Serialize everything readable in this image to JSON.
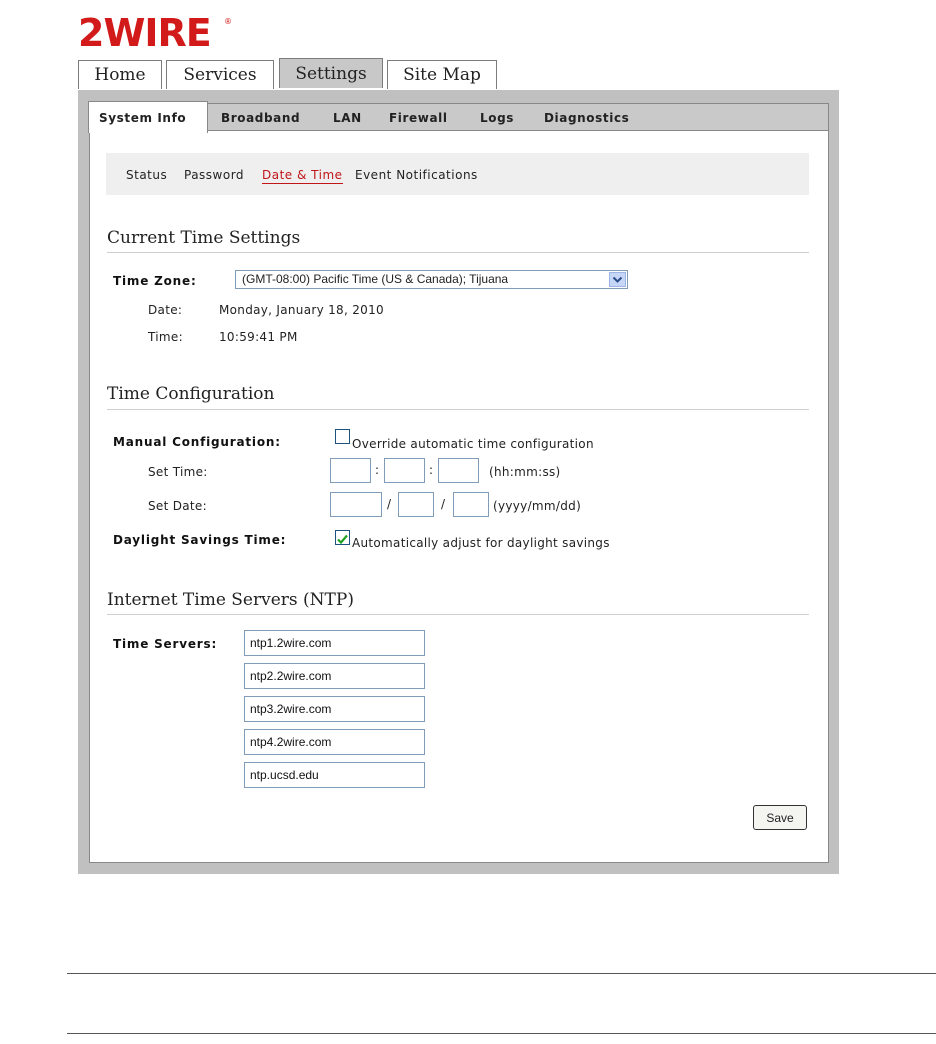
{
  "brand": {
    "logo_text": "2WIRE"
  },
  "top_tabs": [
    {
      "label": "Home"
    },
    {
      "label": "Services"
    },
    {
      "label": "Settings",
      "active": true
    },
    {
      "label": "Site Map"
    }
  ],
  "sub_tabs": [
    {
      "label": "System Info",
      "active": true
    },
    {
      "label": "Broadband"
    },
    {
      "label": "LAN"
    },
    {
      "label": "Firewall"
    },
    {
      "label": "Logs"
    },
    {
      "label": "Diagnostics"
    }
  ],
  "subnav": [
    {
      "label": "Status"
    },
    {
      "label": "Password"
    },
    {
      "label": "Date & Time",
      "active": true
    },
    {
      "label": "Event Notifications"
    }
  ],
  "current_time": {
    "title": "Current Time Settings",
    "timezone_label": "Time Zone:",
    "timezone_value": "(GMT-08:00) Pacific Time (US & Canada); Tijuana",
    "date_label": "Date:",
    "date_value": "Monday, January 18, 2010",
    "time_label": "Time:",
    "time_value": "10:59:41 PM"
  },
  "time_config": {
    "title": "Time Configuration",
    "manual_label": "Manual Configuration:",
    "override_label": "Override automatic time configuration",
    "override_checked": false,
    "set_time_label": "Set Time:",
    "time_sep": ":",
    "time_format": "(hh:mm:ss)",
    "set_date_label": "Set Date:",
    "date_sep": "/",
    "date_format": "(yyyy/mm/dd)",
    "dst_label": "Daylight Savings Time:",
    "dst_option_label": "Automatically adjust for daylight savings",
    "dst_checked": true
  },
  "ntp": {
    "title": "Internet Time Servers (NTP)",
    "servers_label": "Time Servers:",
    "servers": [
      "ntp1.2wire.com",
      "ntp2.2wire.com",
      "ntp3.2wire.com",
      "ntp4.2wire.com",
      "ntp.ucsd.edu"
    ]
  },
  "actions": {
    "save_label": "Save"
  },
  "colors": {
    "brand_red": "#d21a1a",
    "active_link": "#c0161a",
    "frame_gray": "#c0c0c0"
  }
}
